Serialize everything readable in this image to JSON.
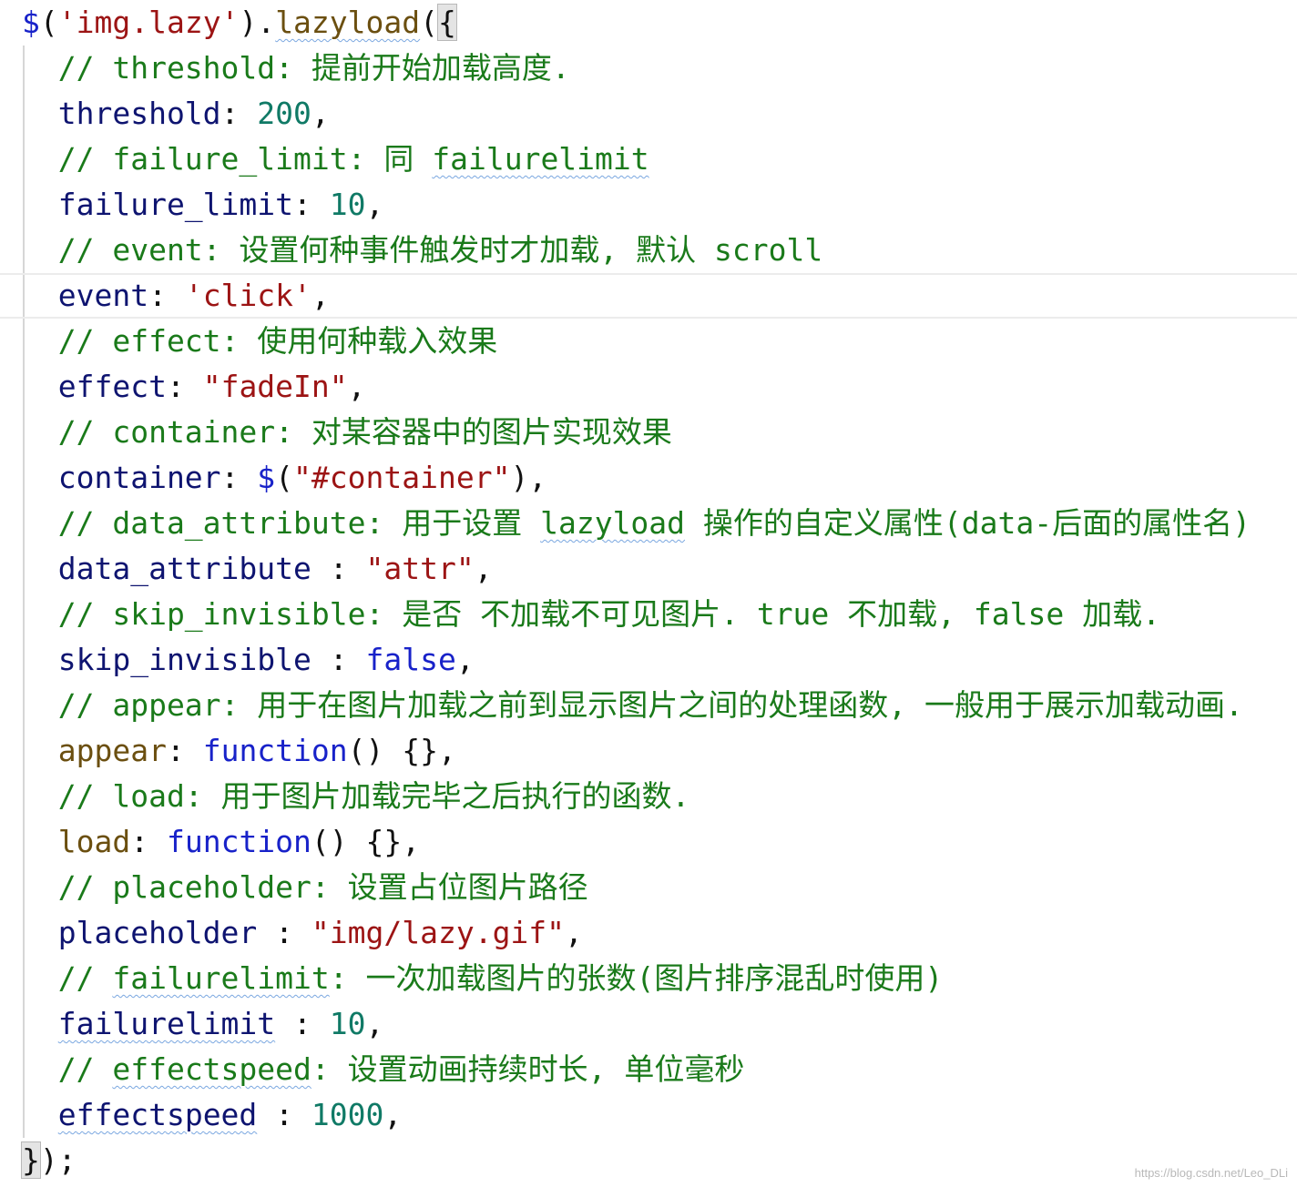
{
  "editor": {
    "lines": [
      [
        {
          "t": "$",
          "c": "kw"
        },
        {
          "t": "(",
          "c": "plain"
        },
        {
          "t": "'img.lazy'",
          "c": "str"
        },
        {
          "t": ").",
          "c": "plain"
        },
        {
          "t": "lazyload",
          "c": "fn",
          "w": true
        },
        {
          "t": "(",
          "c": "plain"
        },
        {
          "t": "{",
          "c": "plain",
          "hl": true
        }
      ],
      [
        {
          "t": "  // threshold: 提前开始加载高度.",
          "c": "comment"
        }
      ],
      [
        {
          "t": "  threshold",
          "c": "prop"
        },
        {
          "t": ": ",
          "c": "plain"
        },
        {
          "t": "200",
          "c": "num"
        },
        {
          "t": ",",
          "c": "plain"
        }
      ],
      [
        {
          "t": "  // failure_limit: 同 ",
          "c": "comment"
        },
        {
          "t": "failurelimit",
          "c": "comment",
          "w": true
        }
      ],
      [
        {
          "t": "  failure_limit",
          "c": "prop"
        },
        {
          "t": ": ",
          "c": "plain"
        },
        {
          "t": "10",
          "c": "num"
        },
        {
          "t": ",",
          "c": "plain"
        }
      ],
      [
        {
          "t": "  // event: 设置何种事件触发时才加载, 默认 scroll",
          "c": "comment"
        }
      ],
      [
        {
          "t": "  event",
          "c": "prop"
        },
        {
          "t": ": ",
          "c": "plain"
        },
        {
          "t": "'click'",
          "c": "str"
        },
        {
          "t": ",",
          "c": "plain"
        }
      ],
      [
        {
          "t": "  // effect: 使用何种载入效果",
          "c": "comment"
        }
      ],
      [
        {
          "t": "  effect",
          "c": "prop"
        },
        {
          "t": ": ",
          "c": "plain"
        },
        {
          "t": "\"fadeIn\"",
          "c": "str"
        },
        {
          "t": ",",
          "c": "plain"
        }
      ],
      [
        {
          "t": "  // container: 对某容器中的图片实现效果",
          "c": "comment"
        }
      ],
      [
        {
          "t": "  container",
          "c": "prop"
        },
        {
          "t": ": ",
          "c": "plain"
        },
        {
          "t": "$",
          "c": "kw"
        },
        {
          "t": "(",
          "c": "plain"
        },
        {
          "t": "\"#container\"",
          "c": "str"
        },
        {
          "t": "),",
          "c": "plain"
        }
      ],
      [
        {
          "t": "  // data_attribute: 用于设置 ",
          "c": "comment"
        },
        {
          "t": "lazyload",
          "c": "comment",
          "w": true
        },
        {
          "t": " 操作的自定义属性(data-后面的属性名)",
          "c": "comment"
        }
      ],
      [
        {
          "t": "  data_attribute",
          "c": "prop"
        },
        {
          "t": " : ",
          "c": "plain"
        },
        {
          "t": "\"attr\"",
          "c": "str"
        },
        {
          "t": ",",
          "c": "plain"
        }
      ],
      [
        {
          "t": "  // skip_invisible: 是否 不加载不可见图片. true 不加载, false 加载.",
          "c": "comment"
        }
      ],
      [
        {
          "t": "  skip_invisible",
          "c": "prop"
        },
        {
          "t": " : ",
          "c": "plain"
        },
        {
          "t": "false",
          "c": "kw"
        },
        {
          "t": ",",
          "c": "plain"
        }
      ],
      [
        {
          "t": "  // appear: 用于在图片加载之前到显示图片之间的处理函数, 一般用于展示加载动画.",
          "c": "comment"
        }
      ],
      [
        {
          "t": "  appear",
          "c": "fn"
        },
        {
          "t": ": ",
          "c": "plain"
        },
        {
          "t": "function",
          "c": "kw"
        },
        {
          "t": "() {},",
          "c": "plain"
        }
      ],
      [
        {
          "t": "  // load: 用于图片加载完毕之后执行的函数.",
          "c": "comment"
        }
      ],
      [
        {
          "t": "  load",
          "c": "fn"
        },
        {
          "t": ": ",
          "c": "plain"
        },
        {
          "t": "function",
          "c": "kw"
        },
        {
          "t": "() {},",
          "c": "plain"
        }
      ],
      [
        {
          "t": "  // placeholder: 设置占位图片路径",
          "c": "comment"
        }
      ],
      [
        {
          "t": "  placeholder",
          "c": "prop"
        },
        {
          "t": " : ",
          "c": "plain"
        },
        {
          "t": "\"img/lazy.gif\"",
          "c": "str"
        },
        {
          "t": ",",
          "c": "plain"
        }
      ],
      [
        {
          "t": "  // ",
          "c": "comment"
        },
        {
          "t": "failurelimit",
          "c": "comment",
          "w": true
        },
        {
          "t": ": 一次加载图片的张数(图片排序混乱时使用)",
          "c": "comment"
        }
      ],
      [
        {
          "t": "  ",
          "c": "prop"
        },
        {
          "t": "failurelimit",
          "c": "prop",
          "w": true
        },
        {
          "t": " : ",
          "c": "plain"
        },
        {
          "t": "10",
          "c": "num"
        },
        {
          "t": ",",
          "c": "plain"
        }
      ],
      [
        {
          "t": "  // ",
          "c": "comment"
        },
        {
          "t": "effectspeed",
          "c": "comment",
          "w": true
        },
        {
          "t": ": 设置动画持续时长, 单位毫秒",
          "c": "comment"
        }
      ],
      [
        {
          "t": "  ",
          "c": "prop"
        },
        {
          "t": "effectspeed",
          "c": "prop",
          "w": true
        },
        {
          "t": " : ",
          "c": "plain"
        },
        {
          "t": "1000",
          "c": "num"
        },
        {
          "t": ",",
          "c": "plain"
        }
      ],
      [
        {
          "t": "}",
          "c": "plain",
          "hl": true
        },
        {
          "t": ");",
          "c": "plain"
        }
      ]
    ],
    "current_line_index": 6
  },
  "watermark": "https://blog.csdn.net/Leo_DLi"
}
